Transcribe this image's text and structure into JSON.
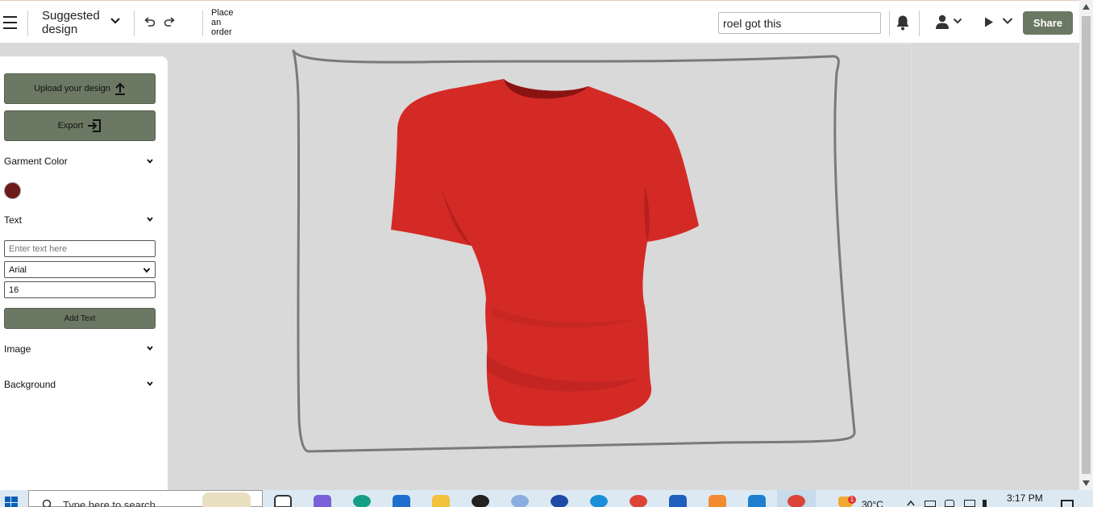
{
  "toolbar": {
    "design_name": "Suggested design",
    "place_order_label": "Place an order",
    "search_value": "roel got this",
    "share_label": "Share"
  },
  "sidebar": {
    "upload_label": "Upload your design",
    "export_label": "Export",
    "garment_color_title": "Garment Color",
    "garment_color_value": "#6f1a1a",
    "text_section_title": "Text",
    "text_input_placeholder": "Enter text here",
    "font_value": "Arial",
    "font_size_value": "16",
    "add_text_label": "Add Text",
    "image_section_title": "Image",
    "background_section_title": "Background"
  },
  "canvas": {
    "garment_color": "#d42a26",
    "background_color": "#d9d9d9"
  },
  "taskbar": {
    "search_placeholder": "Type here to search",
    "temperature": "30°C",
    "time": "3:17 PM",
    "notification_count": "1"
  },
  "icons": [
    "hamburger-menu-icon",
    "chevron-down-icon",
    "undo-icon",
    "redo-icon",
    "bell-icon",
    "user-icon",
    "play-icon",
    "upload-icon",
    "export-icon",
    "windows-start-icon",
    "search-icon"
  ],
  "theme": {
    "accent": "#6b7863"
  }
}
